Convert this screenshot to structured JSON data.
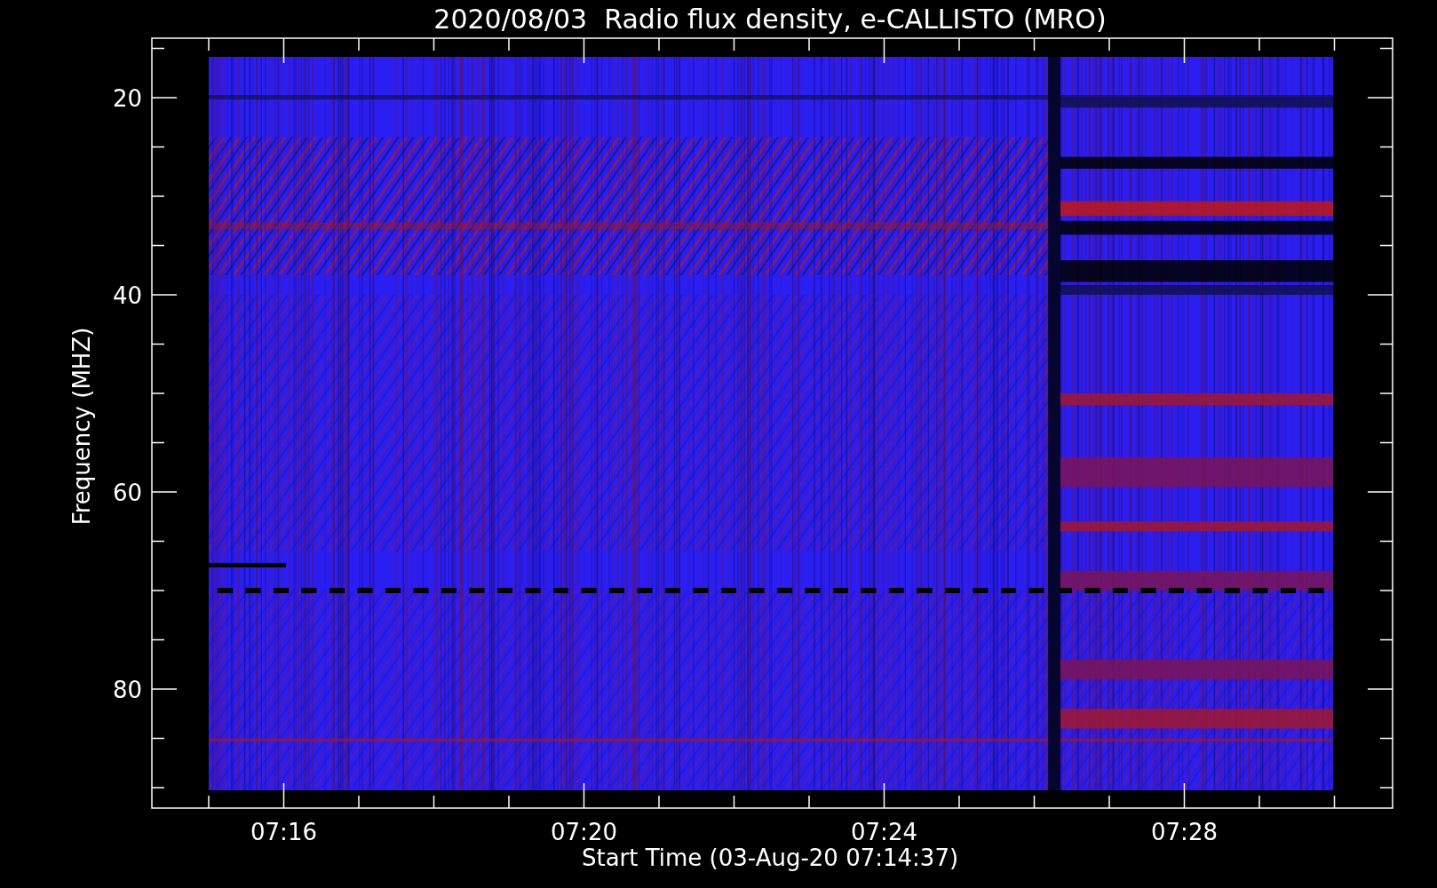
{
  "title": "2020/08/03  Radio flux density, e-CALLISTO (MRO)",
  "y_axis": {
    "label": "Frequency (MHZ)",
    "ticks": [
      "20",
      "40",
      "60",
      "80"
    ]
  },
  "x_axis": {
    "label": "Start Time (03-Aug-20 07:14:37)",
    "ticks": [
      "07:16",
      "07:20",
      "07:24",
      "07:28"
    ]
  }
}
